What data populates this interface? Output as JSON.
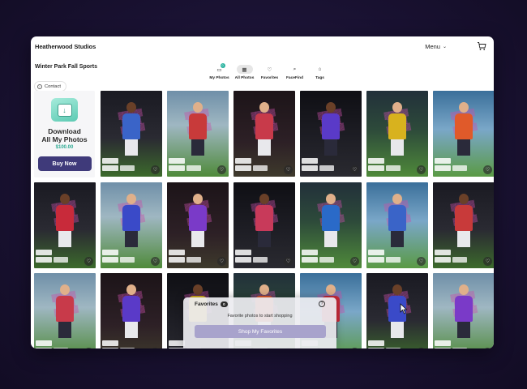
{
  "header": {
    "brand": "Heatherwood Studios",
    "menu_label": "Menu",
    "cart_icon": "cart-icon"
  },
  "gallery": {
    "title": "Winter Park Fall Sports",
    "contact_label": "Contact"
  },
  "tabs": [
    {
      "label": "My Photos",
      "icon": "my-photos-icon",
      "badge": "0",
      "active": false
    },
    {
      "label": "All Photos",
      "icon": "grid-icon",
      "active": true
    },
    {
      "label": "Favorites",
      "icon": "heart-icon",
      "active": false
    },
    {
      "label": "FaceFind",
      "icon": "search-icon",
      "active": false
    },
    {
      "label": "Tags",
      "icon": "tag-icon",
      "active": false
    }
  ],
  "promo": {
    "title_line1": "Download",
    "title_line2": "All My Photos",
    "price": "$100.00",
    "button": "Buy Now"
  },
  "favorites_panel": {
    "title": "Favorites",
    "count": "0",
    "subtitle": "Favorite photos to start shopping",
    "button": "Shop My Favorites"
  },
  "colors": {
    "accent_teal": "#2eaa93",
    "button_purple": "#3f3a7a",
    "shop_button_disabled": "#a8a3cc"
  }
}
